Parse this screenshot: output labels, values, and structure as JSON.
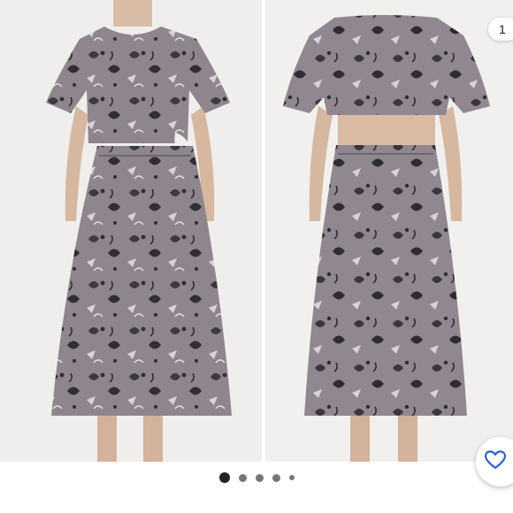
{
  "gallery": {
    "image_counter": "1",
    "slide_count": 5,
    "active_slide": 1,
    "images": [
      {
        "icon": "dress-front-photo"
      },
      {
        "icon": "dress-back-photo"
      }
    ]
  },
  "actions": {
    "like_icon": "heart-outline-icon"
  },
  "colors": {
    "dress": "#8f858d",
    "print": "#3b3a3f",
    "accent_blue": "#2c62c9",
    "dot_active": "#222222",
    "dot_inactive": "#777777"
  }
}
